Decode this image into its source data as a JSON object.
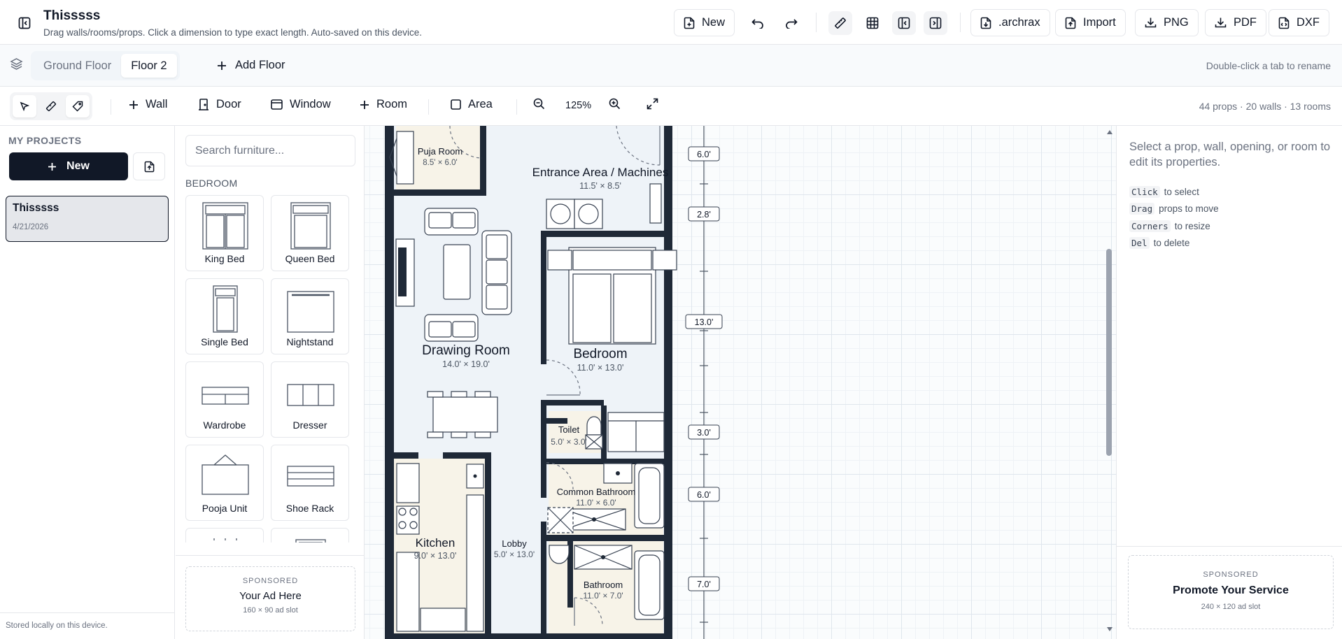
{
  "header": {
    "title": "Thisssss",
    "subtitle": "Drag walls/rooms/props. Click a dimension to type exact length. Auto-saved on this device.",
    "new_label": "New",
    "archrax_label": ".archrax",
    "import_label": "Import",
    "png_label": "PNG",
    "pdf_label": "PDF",
    "dxf_label": "DXF"
  },
  "floors": {
    "tabs": [
      "Ground Floor",
      "Floor 2"
    ],
    "active_tab": "Floor 2",
    "add_label": "Add Floor",
    "rename_hint": "Double-click a tab to rename"
  },
  "tools": {
    "wall_label": "Wall",
    "door_label": "Door",
    "window_label": "Window",
    "room_label": "Room",
    "area_label": "Area",
    "zoom": "125%",
    "stats": "44 props · 20 walls · 13 rooms"
  },
  "projects": {
    "heading": "MY PROJECTS",
    "new_label": "New",
    "items": [
      {
        "name": "Thisssss",
        "date": "4/21/2026"
      }
    ],
    "storage_note": "Stored locally on this device."
  },
  "furniture": {
    "search_placeholder": "Search furniture...",
    "category": "BEDROOM",
    "items": [
      "King Bed",
      "Queen Bed",
      "Single Bed",
      "Nightstand",
      "Wardrobe",
      "Dresser",
      "Pooja Unit",
      "Shoe Rack"
    ],
    "ad": {
      "label": "SPONSORED",
      "title": "Your Ad Here",
      "size": "160 × 90 ad slot"
    }
  },
  "plan": {
    "rooms": [
      {
        "name": "Puja Room",
        "dims": "8.5' × 6.0'"
      },
      {
        "name": "Entrance Area / Machines",
        "dims": "11.5' × 8.5'"
      },
      {
        "name": "Drawing Room",
        "dims": "14.0' × 19.0'"
      },
      {
        "name": "Bedroom",
        "dims": "11.0' × 13.0'"
      },
      {
        "name": "Toilet",
        "dims": "5.0' × 3.0'"
      },
      {
        "name": "Common Bathroom",
        "dims": "11.0' × 6.0'"
      },
      {
        "name": "Kitchen",
        "dims": "9.0' × 13.0'"
      },
      {
        "name": "Lobby",
        "dims": "5.0' × 13.0'"
      },
      {
        "name": "Bathroom",
        "dims": "11.0' × 7.0'"
      }
    ],
    "dimensions": [
      "6.0'",
      "2.8'",
      "13.0'",
      "3.0'",
      "6.0'",
      "7.0'"
    ]
  },
  "properties": {
    "intro": "Select a prop, wall, opening, or room to edit its properties.",
    "tips": [
      {
        "key": "Click",
        "text": "to select"
      },
      {
        "key": "Drag",
        "text": "props to move"
      },
      {
        "key": "Corners",
        "text": "to resize"
      },
      {
        "key": "Del",
        "text": "to delete"
      }
    ],
    "ad": {
      "label": "SPONSORED",
      "title": "Promote Your Service",
      "size": "240 × 120 ad slot"
    }
  },
  "colors": {
    "primary": "#111827",
    "wall": "#1f2937",
    "room_fill": "#eef3f8",
    "kitchen_fill": "#f7f3e8",
    "muted_text": "#6b7280"
  }
}
